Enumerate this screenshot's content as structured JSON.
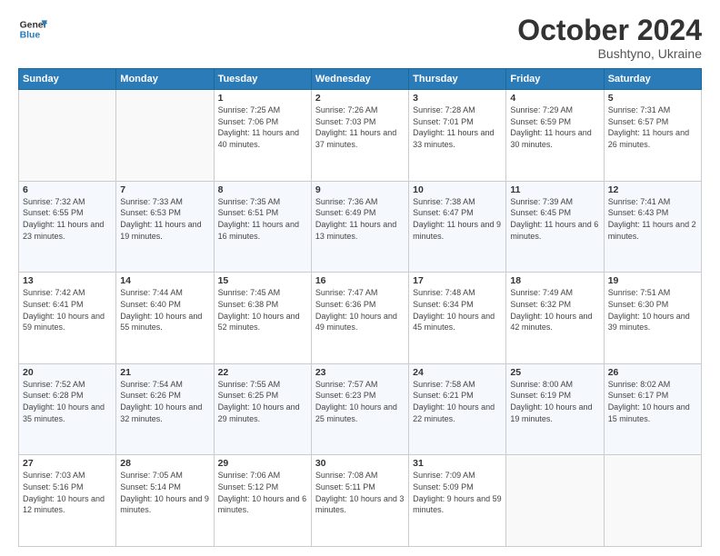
{
  "header": {
    "logo_line1": "General",
    "logo_line2": "Blue",
    "main_title": "October 2024",
    "subtitle": "Bushtyno, Ukraine"
  },
  "days_of_week": [
    "Sunday",
    "Monday",
    "Tuesday",
    "Wednesday",
    "Thursday",
    "Friday",
    "Saturday"
  ],
  "weeks": [
    [
      null,
      null,
      {
        "day": 1,
        "sunrise": "Sunrise: 7:25 AM",
        "sunset": "Sunset: 7:06 PM",
        "daylight": "Daylight: 11 hours and 40 minutes."
      },
      {
        "day": 2,
        "sunrise": "Sunrise: 7:26 AM",
        "sunset": "Sunset: 7:03 PM",
        "daylight": "Daylight: 11 hours and 37 minutes."
      },
      {
        "day": 3,
        "sunrise": "Sunrise: 7:28 AM",
        "sunset": "Sunset: 7:01 PM",
        "daylight": "Daylight: 11 hours and 33 minutes."
      },
      {
        "day": 4,
        "sunrise": "Sunrise: 7:29 AM",
        "sunset": "Sunset: 6:59 PM",
        "daylight": "Daylight: 11 hours and 30 minutes."
      },
      {
        "day": 5,
        "sunrise": "Sunrise: 7:31 AM",
        "sunset": "Sunset: 6:57 PM",
        "daylight": "Daylight: 11 hours and 26 minutes."
      }
    ],
    [
      {
        "day": 6,
        "sunrise": "Sunrise: 7:32 AM",
        "sunset": "Sunset: 6:55 PM",
        "daylight": "Daylight: 11 hours and 23 minutes."
      },
      {
        "day": 7,
        "sunrise": "Sunrise: 7:33 AM",
        "sunset": "Sunset: 6:53 PM",
        "daylight": "Daylight: 11 hours and 19 minutes."
      },
      {
        "day": 8,
        "sunrise": "Sunrise: 7:35 AM",
        "sunset": "Sunset: 6:51 PM",
        "daylight": "Daylight: 11 hours and 16 minutes."
      },
      {
        "day": 9,
        "sunrise": "Sunrise: 7:36 AM",
        "sunset": "Sunset: 6:49 PM",
        "daylight": "Daylight: 11 hours and 13 minutes."
      },
      {
        "day": 10,
        "sunrise": "Sunrise: 7:38 AM",
        "sunset": "Sunset: 6:47 PM",
        "daylight": "Daylight: 11 hours and 9 minutes."
      },
      {
        "day": 11,
        "sunrise": "Sunrise: 7:39 AM",
        "sunset": "Sunset: 6:45 PM",
        "daylight": "Daylight: 11 hours and 6 minutes."
      },
      {
        "day": 12,
        "sunrise": "Sunrise: 7:41 AM",
        "sunset": "Sunset: 6:43 PM",
        "daylight": "Daylight: 11 hours and 2 minutes."
      }
    ],
    [
      {
        "day": 13,
        "sunrise": "Sunrise: 7:42 AM",
        "sunset": "Sunset: 6:41 PM",
        "daylight": "Daylight: 10 hours and 59 minutes."
      },
      {
        "day": 14,
        "sunrise": "Sunrise: 7:44 AM",
        "sunset": "Sunset: 6:40 PM",
        "daylight": "Daylight: 10 hours and 55 minutes."
      },
      {
        "day": 15,
        "sunrise": "Sunrise: 7:45 AM",
        "sunset": "Sunset: 6:38 PM",
        "daylight": "Daylight: 10 hours and 52 minutes."
      },
      {
        "day": 16,
        "sunrise": "Sunrise: 7:47 AM",
        "sunset": "Sunset: 6:36 PM",
        "daylight": "Daylight: 10 hours and 49 minutes."
      },
      {
        "day": 17,
        "sunrise": "Sunrise: 7:48 AM",
        "sunset": "Sunset: 6:34 PM",
        "daylight": "Daylight: 10 hours and 45 minutes."
      },
      {
        "day": 18,
        "sunrise": "Sunrise: 7:49 AM",
        "sunset": "Sunset: 6:32 PM",
        "daylight": "Daylight: 10 hours and 42 minutes."
      },
      {
        "day": 19,
        "sunrise": "Sunrise: 7:51 AM",
        "sunset": "Sunset: 6:30 PM",
        "daylight": "Daylight: 10 hours and 39 minutes."
      }
    ],
    [
      {
        "day": 20,
        "sunrise": "Sunrise: 7:52 AM",
        "sunset": "Sunset: 6:28 PM",
        "daylight": "Daylight: 10 hours and 35 minutes."
      },
      {
        "day": 21,
        "sunrise": "Sunrise: 7:54 AM",
        "sunset": "Sunset: 6:26 PM",
        "daylight": "Daylight: 10 hours and 32 minutes."
      },
      {
        "day": 22,
        "sunrise": "Sunrise: 7:55 AM",
        "sunset": "Sunset: 6:25 PM",
        "daylight": "Daylight: 10 hours and 29 minutes."
      },
      {
        "day": 23,
        "sunrise": "Sunrise: 7:57 AM",
        "sunset": "Sunset: 6:23 PM",
        "daylight": "Daylight: 10 hours and 25 minutes."
      },
      {
        "day": 24,
        "sunrise": "Sunrise: 7:58 AM",
        "sunset": "Sunset: 6:21 PM",
        "daylight": "Daylight: 10 hours and 22 minutes."
      },
      {
        "day": 25,
        "sunrise": "Sunrise: 8:00 AM",
        "sunset": "Sunset: 6:19 PM",
        "daylight": "Daylight: 10 hours and 19 minutes."
      },
      {
        "day": 26,
        "sunrise": "Sunrise: 8:02 AM",
        "sunset": "Sunset: 6:17 PM",
        "daylight": "Daylight: 10 hours and 15 minutes."
      }
    ],
    [
      {
        "day": 27,
        "sunrise": "Sunrise: 7:03 AM",
        "sunset": "Sunset: 5:16 PM",
        "daylight": "Daylight: 10 hours and 12 minutes."
      },
      {
        "day": 28,
        "sunrise": "Sunrise: 7:05 AM",
        "sunset": "Sunset: 5:14 PM",
        "daylight": "Daylight: 10 hours and 9 minutes."
      },
      {
        "day": 29,
        "sunrise": "Sunrise: 7:06 AM",
        "sunset": "Sunset: 5:12 PM",
        "daylight": "Daylight: 10 hours and 6 minutes."
      },
      {
        "day": 30,
        "sunrise": "Sunrise: 7:08 AM",
        "sunset": "Sunset: 5:11 PM",
        "daylight": "Daylight: 10 hours and 3 minutes."
      },
      {
        "day": 31,
        "sunrise": "Sunrise: 7:09 AM",
        "sunset": "Sunset: 5:09 PM",
        "daylight": "Daylight: 9 hours and 59 minutes."
      },
      null,
      null
    ]
  ]
}
